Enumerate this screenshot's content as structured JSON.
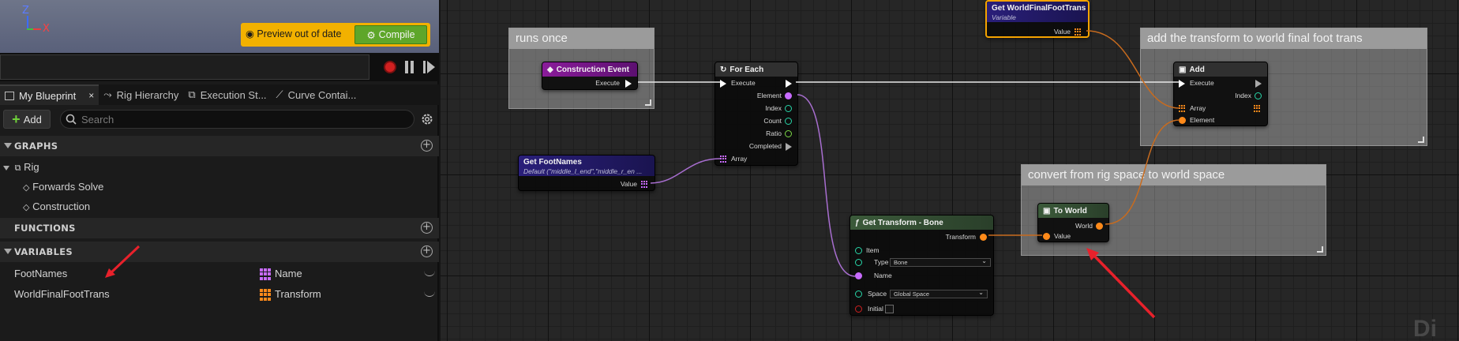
{
  "viewport": {
    "axis_z": "Z",
    "axis_x": "X",
    "preview_badge": "Preview out of date",
    "compile_label": "Compile"
  },
  "tabs": [
    {
      "label": "My Blueprint",
      "close": "×"
    },
    {
      "label": "Rig Hierarchy"
    },
    {
      "label": "Execution St..."
    },
    {
      "label": "Curve Contai..."
    }
  ],
  "toolbar": {
    "add_label": "Add",
    "search_placeholder": "Search"
  },
  "sections": {
    "graphs": "GRAPHS",
    "functions": "FUNCTIONS",
    "variables": "VARIABLES"
  },
  "graphs_tree": {
    "rig": "Rig",
    "forwards_solve": "Forwards Solve",
    "construction": "Construction"
  },
  "variables": [
    {
      "name": "FootNames",
      "type": "Name",
      "type_color": "#c86bff"
    },
    {
      "name": "WorldFinalFootTrans",
      "type": "Transform",
      "type_color": "#ff8a1a"
    }
  ],
  "comments": {
    "runs_once": "runs once",
    "add_transform": "add the transform to world final foot trans",
    "convert": "convert from rig space to world space"
  },
  "nodes": {
    "construction_event": {
      "title": "Construction Event",
      "execute": "Execute"
    },
    "for_each": {
      "title": "For Each",
      "execute": "Execute",
      "element": "Element",
      "index": "Index",
      "count": "Count",
      "ratio": "Ratio",
      "completed": "Completed",
      "array": "Array"
    },
    "get_foot_names": {
      "title": "Get FootNames",
      "subtitle": "Default (\"middle_l_end\",\"middle_r_en ...",
      "value": "Value"
    },
    "get_world_final": {
      "title": "Get WorldFinalFootTrans",
      "subtitle": "Variable",
      "value": "Value"
    },
    "add": {
      "title": "Add",
      "execute": "Execute",
      "index": "Index",
      "array": "Array",
      "element": "Element"
    },
    "to_world": {
      "title": "To World",
      "world": "World",
      "value": "Value"
    },
    "get_transform": {
      "title": "Get Transform - Bone",
      "transform": "Transform",
      "item": "Item",
      "type": "Type",
      "type_value": "Bone",
      "name": "Name",
      "space": "Space",
      "space_value": "Global Space",
      "initial": "Initial"
    }
  },
  "colors": {
    "exec_wire": "#e8e8e8",
    "name_wire": "#a86ed0",
    "transform_wire": "#c86b1e",
    "annotation_red": "#e8212b",
    "compile_green": "#5ea62a",
    "preview_yellow": "#f2b100"
  },
  "watermark": "Di"
}
